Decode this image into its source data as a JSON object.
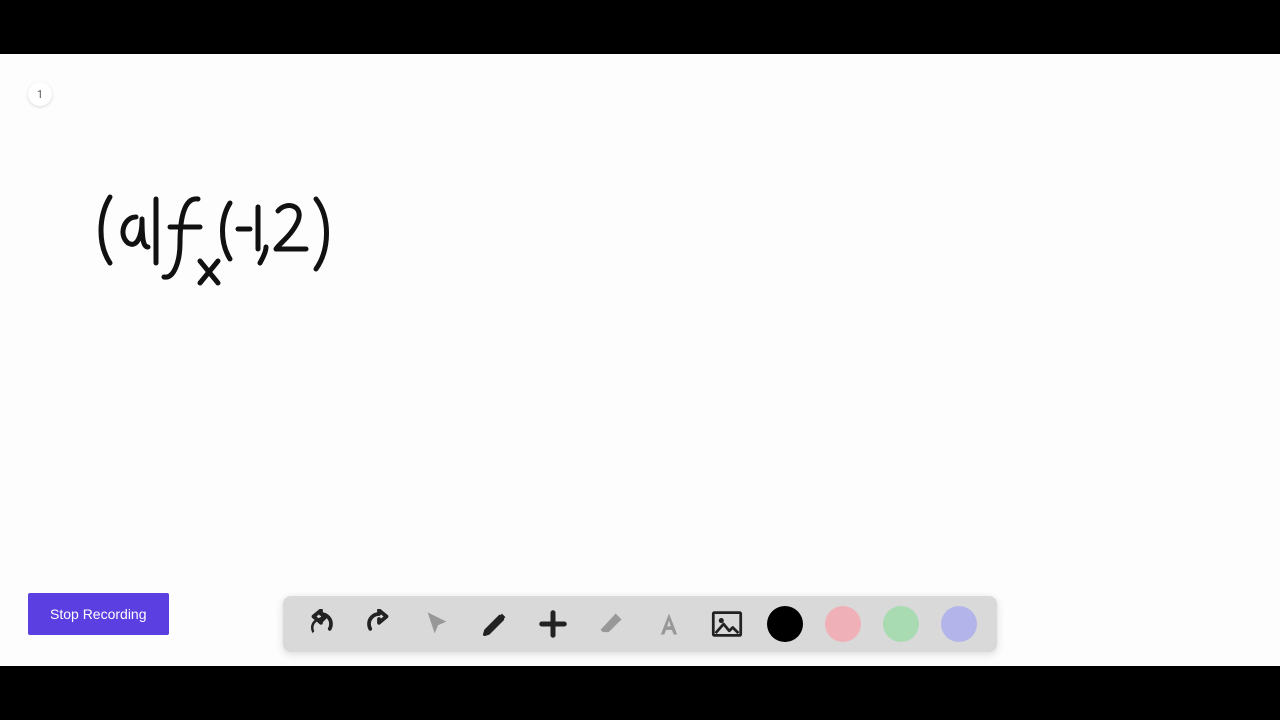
{
  "page": {
    "number": "1"
  },
  "handwriting": {
    "text": "(a) f_x(-1,2)"
  },
  "controls": {
    "stop_label": "Stop Recording"
  },
  "toolbar": {
    "undo": "undo-icon",
    "redo": "redo-icon",
    "pointer": "pointer-icon",
    "pencil": "pencil-icon",
    "plus": "plus-icon",
    "eraser": "eraser-icon",
    "text": "text-icon",
    "image": "image-icon"
  },
  "colors": {
    "black": "#000000",
    "pink": "#f0b0b8",
    "green": "#a8dbb2",
    "purple": "#b3b5ea"
  }
}
